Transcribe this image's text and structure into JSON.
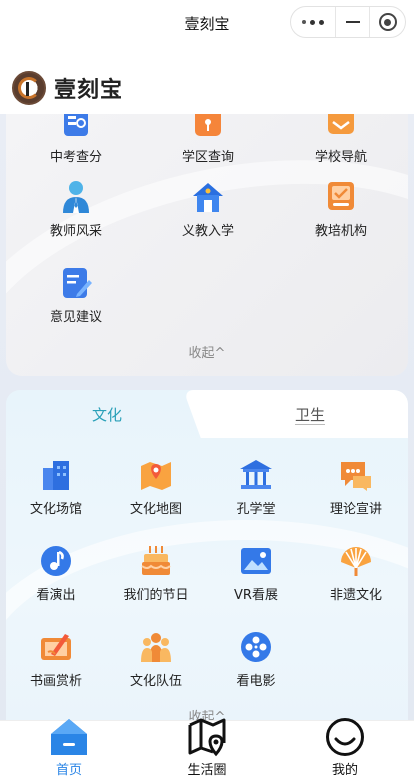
{
  "window": {
    "title": "壹刻宝"
  },
  "brand": {
    "name": "壹刻宝"
  },
  "edu": {
    "items": [
      {
        "label": "中考查分",
        "icon": "score-query-icon"
      },
      {
        "label": "学区查询",
        "icon": "school-district-icon"
      },
      {
        "label": "学校导航",
        "icon": "school-nav-icon"
      },
      {
        "label": "教师风采",
        "icon": "teacher-icon"
      },
      {
        "label": "义教入学",
        "icon": "enrollment-icon"
      },
      {
        "label": "教培机构",
        "icon": "training-org-icon"
      },
      {
        "label": "意见建议",
        "icon": "feedback-icon"
      }
    ],
    "collapse": "收起^"
  },
  "culture": {
    "tabs": [
      "文化",
      "卫生"
    ],
    "items": [
      {
        "label": "文化场馆",
        "icon": "venue-icon"
      },
      {
        "label": "文化地图",
        "icon": "culture-map-icon"
      },
      {
        "label": "孔学堂",
        "icon": "temple-icon"
      },
      {
        "label": "理论宣讲",
        "icon": "lecture-icon"
      },
      {
        "label": "看演出",
        "icon": "performance-icon"
      },
      {
        "label": "我们的节日",
        "icon": "festival-icon"
      },
      {
        "label": "VR看展",
        "icon": "vr-exhibit-icon"
      },
      {
        "label": "非遗文化",
        "icon": "heritage-icon"
      },
      {
        "label": "书画赏析",
        "icon": "painting-icon"
      },
      {
        "label": "文化队伍",
        "icon": "team-icon"
      },
      {
        "label": "看电影",
        "icon": "movie-icon"
      }
    ],
    "collapse": "收起^"
  },
  "tabbar": {
    "items": [
      {
        "label": "首页",
        "icon": "home-icon"
      },
      {
        "label": "生活圈",
        "icon": "map-pin-icon"
      },
      {
        "label": "我的",
        "icon": "smile-icon"
      }
    ],
    "active_color": "#2a85e6"
  }
}
